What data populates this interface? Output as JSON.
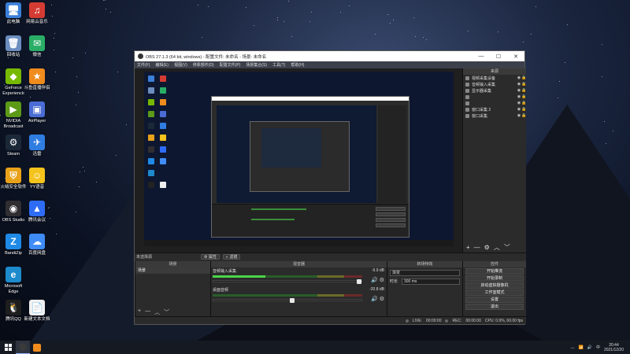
{
  "desktop": {
    "icons": [
      {
        "label": "此电脑",
        "color": "#3b7fd9",
        "glyph": "🖥"
      },
      {
        "label": "网易云音乐",
        "color": "#d43c33",
        "glyph": "♫"
      },
      {
        "label": "回收站",
        "color": "#6c8ebf",
        "glyph": "🗑"
      },
      {
        "label": "微信",
        "color": "#2aae67",
        "glyph": "✉"
      },
      {
        "label": "GeForce Experience",
        "color": "#76b900",
        "glyph": "◆"
      },
      {
        "label": "斗鱼直播伴侣",
        "color": "#f08c1e",
        "glyph": "★"
      },
      {
        "label": "NVIDIA Broadcast",
        "color": "#5c9a18",
        "glyph": "▶"
      },
      {
        "label": "AirPlayer",
        "color": "#4a6cd4",
        "glyph": "▣"
      },
      {
        "label": "Steam",
        "color": "#1b2838",
        "glyph": "⚙"
      },
      {
        "label": "迅雷",
        "color": "#2f7de1",
        "glyph": "✈"
      },
      {
        "label": "火绒安全软件",
        "color": "#e8a21a",
        "glyph": "⛨"
      },
      {
        "label": "YY语音",
        "color": "#f4c31c",
        "glyph": "☺"
      },
      {
        "label": "OBS Studio",
        "color": "#302e31",
        "glyph": "◉"
      },
      {
        "label": "腾讯会议",
        "color": "#2e6cf6",
        "glyph": "▲"
      },
      {
        "label": "BandiZip",
        "color": "#1f8ae6",
        "glyph": "Z"
      },
      {
        "label": "百度网盘",
        "color": "#3f8cf7",
        "glyph": "☁"
      },
      {
        "label": "Microsoft Edge",
        "color": "#1d8acc",
        "glyph": "e"
      },
      {
        "label": "",
        "color": "transparent",
        "glyph": ""
      },
      {
        "label": "腾讯QQ",
        "color": "#1e1e1e",
        "glyph": "🐧"
      },
      {
        "label": "新建文本文档",
        "color": "#f0f0f0",
        "glyph": "📄"
      }
    ]
  },
  "obs": {
    "title": "OBS 27.1.3 (64 bit, windows) - 配置文件: 未命名 - 场景: 未命名",
    "window_controls": {
      "minimize": "—",
      "maximize": "☐",
      "close": "✕"
    },
    "menu": [
      "文件(F)",
      "编辑(E)",
      "视图(V)",
      "停靠部件(D)",
      "配置文件(P)",
      "场景集合(S)",
      "工具(T)",
      "帮助(H)"
    ],
    "sources_panel": {
      "header": "来源",
      "items": [
        {
          "name": "视频采集设备"
        },
        {
          "name": "音频输入采集"
        },
        {
          "name": "显示器采集"
        },
        {
          "name": ""
        },
        {
          "name": ""
        },
        {
          "name": "窗口采集 2"
        },
        {
          "name": "窗口采集"
        }
      ],
      "tools": [
        "+",
        "—",
        "⚙",
        "︿",
        "﹀"
      ]
    },
    "source_strip": {
      "no_source": "未选择源",
      "properties": "属性",
      "filters": "滤镜"
    },
    "scenes": {
      "header": "场景",
      "items": [
        "场景"
      ],
      "tools": [
        "+",
        "—",
        "︿",
        "﹀"
      ]
    },
    "mixer": {
      "header": "混音器",
      "channels": [
        {
          "name": "音频输入采集",
          "db": "-9.9 dB",
          "level": 0.35,
          "volume": 1.0
        },
        {
          "name": "桌面音频",
          "db": "-20.8 dB",
          "level": 0.0,
          "volume": 0.55
        }
      ]
    },
    "transitions": {
      "header": "转场特效",
      "selected": "渐变",
      "duration_label": "时长",
      "duration_value": "300 ms"
    },
    "controls": {
      "header": "控件",
      "buttons": [
        "开始推流",
        "开始录制",
        "启动虚拟摄像机",
        "工作室模式",
        "设置",
        "退出"
      ]
    },
    "status": {
      "live_label": "LIVE:",
      "live_time": "00:00:00",
      "rec_label": "REC:",
      "rec_time": "00:00:00",
      "cpu": "CPU: 0.9%, 60.00 fps"
    }
  },
  "taskbar": {
    "time": "20:44",
    "date": "2021/12/20",
    "tray_icons": [
      "︿",
      "📶",
      "🔊",
      "中"
    ]
  }
}
